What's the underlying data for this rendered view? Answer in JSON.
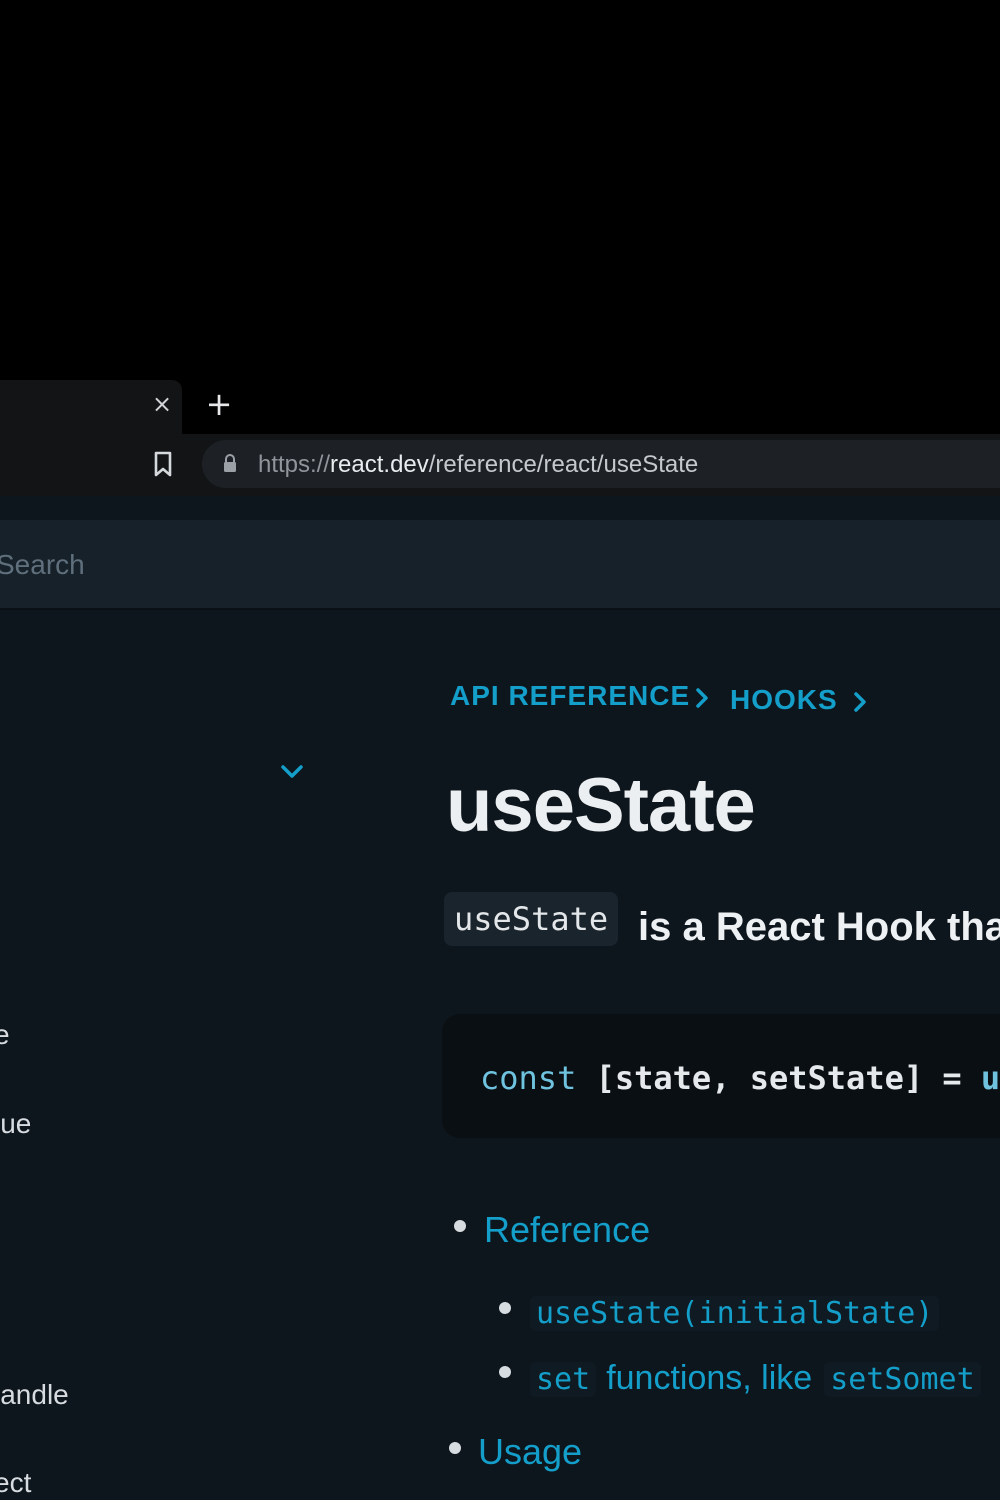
{
  "browser": {
    "tab_close_glyph": "×",
    "new_tab_glyph": "+",
    "url": {
      "scheme": "https://",
      "host": "react.dev",
      "path": "/reference/react/useState"
    }
  },
  "header": {
    "search_label": "Search"
  },
  "sidebar": {
    "items": [
      {
        "label": "e"
      },
      {
        "label": "lue"
      },
      {
        "label": "landle"
      },
      {
        "label": "ect"
      }
    ]
  },
  "breadcrumb": [
    {
      "label": "API REFERENCE"
    },
    {
      "label": "HOOKS"
    }
  ],
  "page": {
    "title": "useState",
    "intro_code": "useState",
    "intro_text": "is a React Hook tha",
    "code": {
      "keyword": "const",
      "body": " [state, setState] = ",
      "fn": "u"
    }
  },
  "toc": {
    "reference": "Reference",
    "sub_items": [
      {
        "code": "useState(initialState)"
      },
      {
        "code": "set",
        "text": "functions, like",
        "code2": "setSomet"
      }
    ],
    "usage": "Usage"
  },
  "colors": {
    "accent": "#149eca",
    "background": "#0e161d",
    "header": "#17212a"
  }
}
